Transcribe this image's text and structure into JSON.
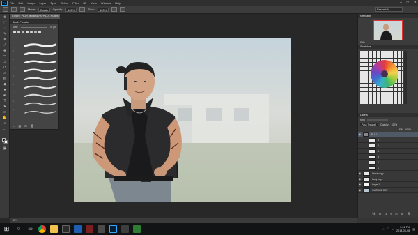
{
  "menubar": {
    "app_logo": "Ps",
    "items": [
      "File",
      "Edit",
      "Image",
      "Layer",
      "Type",
      "Select",
      "Filter",
      "3D",
      "View",
      "Window",
      "Help"
    ]
  },
  "options": {
    "mode_label": "Mode:",
    "mode_value": "Brush",
    "opacity_label": "Opacity:",
    "opacity_value": "100%",
    "flow_label": "Flow:",
    "flow_value": "100%",
    "workspace": "Essentials"
  },
  "document": {
    "tab_title": "CIVARI_PILLY.psd @ 50% (PILLY, RGB/8) *"
  },
  "brush_panel": {
    "title": "Brush Presets",
    "size_label": "Size:",
    "size_value": "70 px"
  },
  "right": {
    "navigator_tab": "Navigator",
    "zoom": "50%",
    "swatches_tab": "Swatches",
    "layers_tab": "Layers",
    "kind_label": "Kind",
    "blend_mode": "Pass Through",
    "opacity_label": "Opacity:",
    "opacity_value": "100%",
    "fill_label": "Fill:",
    "fill_value": "100%",
    "layers": [
      {
        "name": "PILLY",
        "group": true
      },
      {
        "name": "6",
        "group": false
      },
      {
        "name": "5",
        "group": false
      },
      {
        "name": "4",
        "group": false
      },
      {
        "name": "3",
        "group": false
      },
      {
        "name": "2",
        "group": false
      },
      {
        "name": "1",
        "group": false
      },
      {
        "name": "Linea copy",
        "group": false
      },
      {
        "name": "body copy",
        "group": false
      },
      {
        "name": "Layer 1",
        "group": false
      },
      {
        "name": "OUTSIDE DAY",
        "group": false
      }
    ]
  },
  "status": {
    "zoom": "50%"
  },
  "taskbar": {
    "time": "3:01 PM",
    "date": "2018-06-08"
  },
  "colors": {
    "accent": "#31a8ff",
    "panel": "#383838",
    "canvas_bg": "#c5d3db"
  }
}
